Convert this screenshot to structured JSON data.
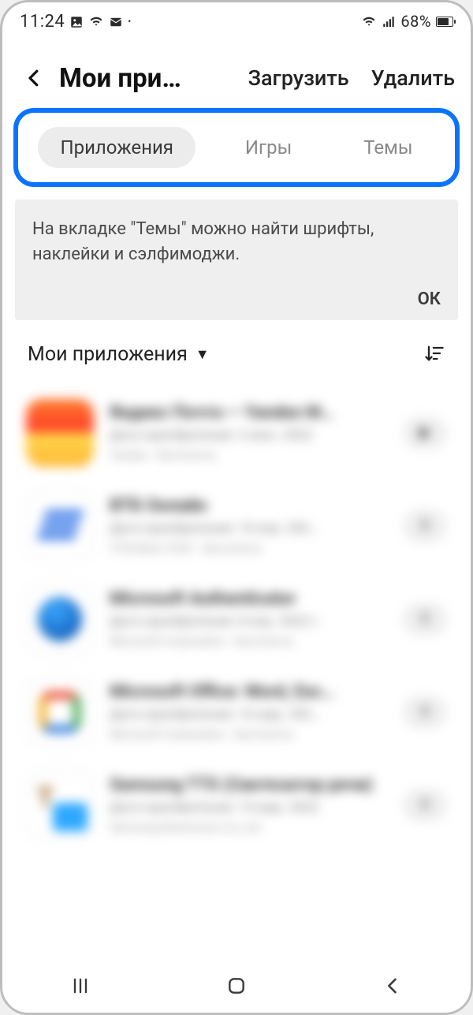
{
  "statusbar": {
    "time": "11:24",
    "battery_pct": "68%"
  },
  "header": {
    "title": "Мои при…",
    "action_download": "Загрузить",
    "action_delete": "Удалить"
  },
  "tabs": {
    "apps": "Приложения",
    "games": "Игры",
    "themes": "Темы"
  },
  "banner": {
    "text": "На вкладке \"Темы\" можно найти шрифты, наклейки и сэлфимоджи.",
    "ok": "ОК"
  },
  "section": {
    "title": "Мои приложения"
  },
  "apps": [
    {
      "name": "Яндекс Почта — Yandex M…",
      "line2": "Дата приобретения: 2 июн. 2022",
      "line3": "Yandex · Бесплатно",
      "action": "play",
      "icon": "ic-mail"
    },
    {
      "name": "ВТБ Онлайн",
      "line2": "Дата приобретения: 10 апр. 202…",
      "line3": "VTB Bank, PJSC · Бесплатно",
      "action": "download",
      "icon": "ic-vtb"
    },
    {
      "name": "Microsoft Authenticator",
      "line2": "Дата приобретения: 8 апр. 2022 г.",
      "line3": "Microsoft Corporation · Бесплатно",
      "action": "download",
      "icon": "ic-auth"
    },
    {
      "name": "Microsoft Office: Word, Exc…",
      "line2": "Дата приобретения: 16 мар. 202…",
      "line3": "Microsoft Corporation · Бесплатно",
      "action": "download",
      "icon": "ic-off"
    },
    {
      "name": "Samsung TTS (Синтезатор речи)",
      "line2": "Дата приобретения: 15 мар. 2022",
      "line3": "Samsung Electronics Co.,Ltd",
      "action": "download",
      "icon": "ic-tts"
    }
  ]
}
